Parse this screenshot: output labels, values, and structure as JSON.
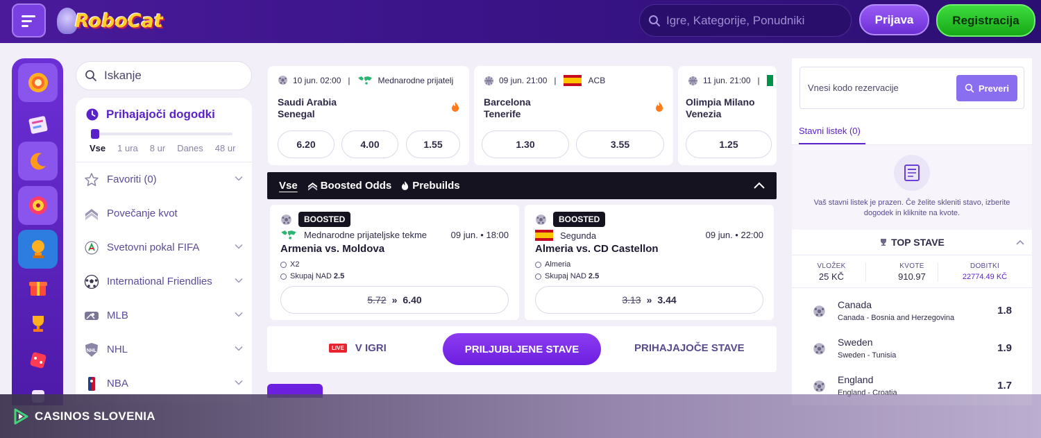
{
  "header": {
    "logo_text": "RoboCat",
    "search_placeholder": "Igre, Kategorije, Ponudniki",
    "login_label": "Prijava",
    "register_label": "Registracija"
  },
  "rail": {
    "icons": [
      "casino-chip-icon",
      "slot-map-icon",
      "crescent-icon",
      "roulette-icon",
      "trophy-ball-icon",
      "gift-icon",
      "cup-icon",
      "dice-icon",
      "misc-icon"
    ]
  },
  "sidebar": {
    "search_placeholder": "Iskanje",
    "upcoming_title": "Prihajajoči dogodki",
    "time_options": [
      "Vse",
      "1 ura",
      "8 ur",
      "Danes",
      "48 ur"
    ],
    "items": [
      {
        "label": "Favoriti (0)",
        "icon": "star-icon"
      },
      {
        "label": "Povečanje kvot",
        "icon": "boost-chevron-icon"
      },
      {
        "label": "Svetovni pokal FIFA",
        "icon": "fifa-icon"
      },
      {
        "label": "International Friendlies",
        "icon": "soccer-ball-icon"
      },
      {
        "label": "MLB",
        "icon": "mlb-icon"
      },
      {
        "label": "NHL",
        "icon": "nhl-icon"
      },
      {
        "label": "NBA",
        "icon": "nba-icon"
      }
    ]
  },
  "events": [
    {
      "date": "10 jun. 02:00",
      "competition": "Mednarodne prijatelj",
      "home": "Saudi Arabia",
      "away": "Senegal",
      "odds": [
        "6.20",
        "4.00",
        "1.55"
      ]
    },
    {
      "date": "09 jun. 21:00",
      "competition": "ACB",
      "home": "Barcelona",
      "away": "Tenerife",
      "odds": [
        "1.30",
        "3.55"
      ]
    },
    {
      "date": "11 jun. 21:00",
      "competition": "",
      "home": "Olimpia Milano",
      "away": "Venezia",
      "odds": [
        "1.25"
      ]
    }
  ],
  "filter_bar": {
    "tabs": [
      "Vse",
      "Boosted Odds",
      "Prebuilds"
    ]
  },
  "boosted": [
    {
      "badge": "BOOSTED",
      "league": "Mednarodne prijateljske tekme",
      "time": "09 jun. • 18:00",
      "match": "Armenia vs. Moldova",
      "selections": [
        {
          "text": "X2",
          "bold": ""
        },
        {
          "text": "Skupaj NAD ",
          "bold": "2.5"
        }
      ],
      "old_odds": "5.72",
      "new_odds": "6.40"
    },
    {
      "badge": "BOOSTED",
      "league": "Segunda",
      "time": "09 jun. • 22:00",
      "match": "Almeria vs. CD Castellon",
      "selections": [
        {
          "text": "Almeria",
          "bold": ""
        },
        {
          "text": "Skupaj NAD ",
          "bold": "2.5"
        }
      ],
      "old_odds": "3.13",
      "new_odds": "3.44"
    }
  ],
  "section_tabs": {
    "live_badge": "LIVE",
    "live": "V IGRI",
    "favorite": "PRILJUBLJENE STAVE",
    "upcoming": "PRIHAJAJOČE STAVE"
  },
  "right": {
    "code_placeholder": "Vnesi kodo rezervacije",
    "check_label": "Preveri",
    "slip_tab": "Stavni listek (0)",
    "empty_text": "Vaš stavni listek je prazen. Če želite skleniti stavo, izberite dogodek in kliknite na kvote.",
    "top_title": "TOP STAVE",
    "stats": [
      {
        "key": "VLOŽEK",
        "value": "25 KČ"
      },
      {
        "key": "KVOTE",
        "value": "910.97"
      },
      {
        "key": "DOBITKI",
        "value": "22774.49 KČ"
      }
    ],
    "top_items": [
      {
        "team": "Canada",
        "match": "Canada - Bosnia and Herzegovina",
        "odd": "1.8"
      },
      {
        "team": "Sweden",
        "match": "Sweden - Tunisia",
        "odd": "1.9"
      },
      {
        "team": "England",
        "match": "England - Croatia",
        "odd": "1.7"
      }
    ]
  },
  "banner": {
    "name": "CASINOS SLOVENIA"
  },
  "colors": {
    "header": "#3a1488",
    "accent": "#5a22c9",
    "register": "#22c022",
    "dark_bar": "#15131f"
  }
}
